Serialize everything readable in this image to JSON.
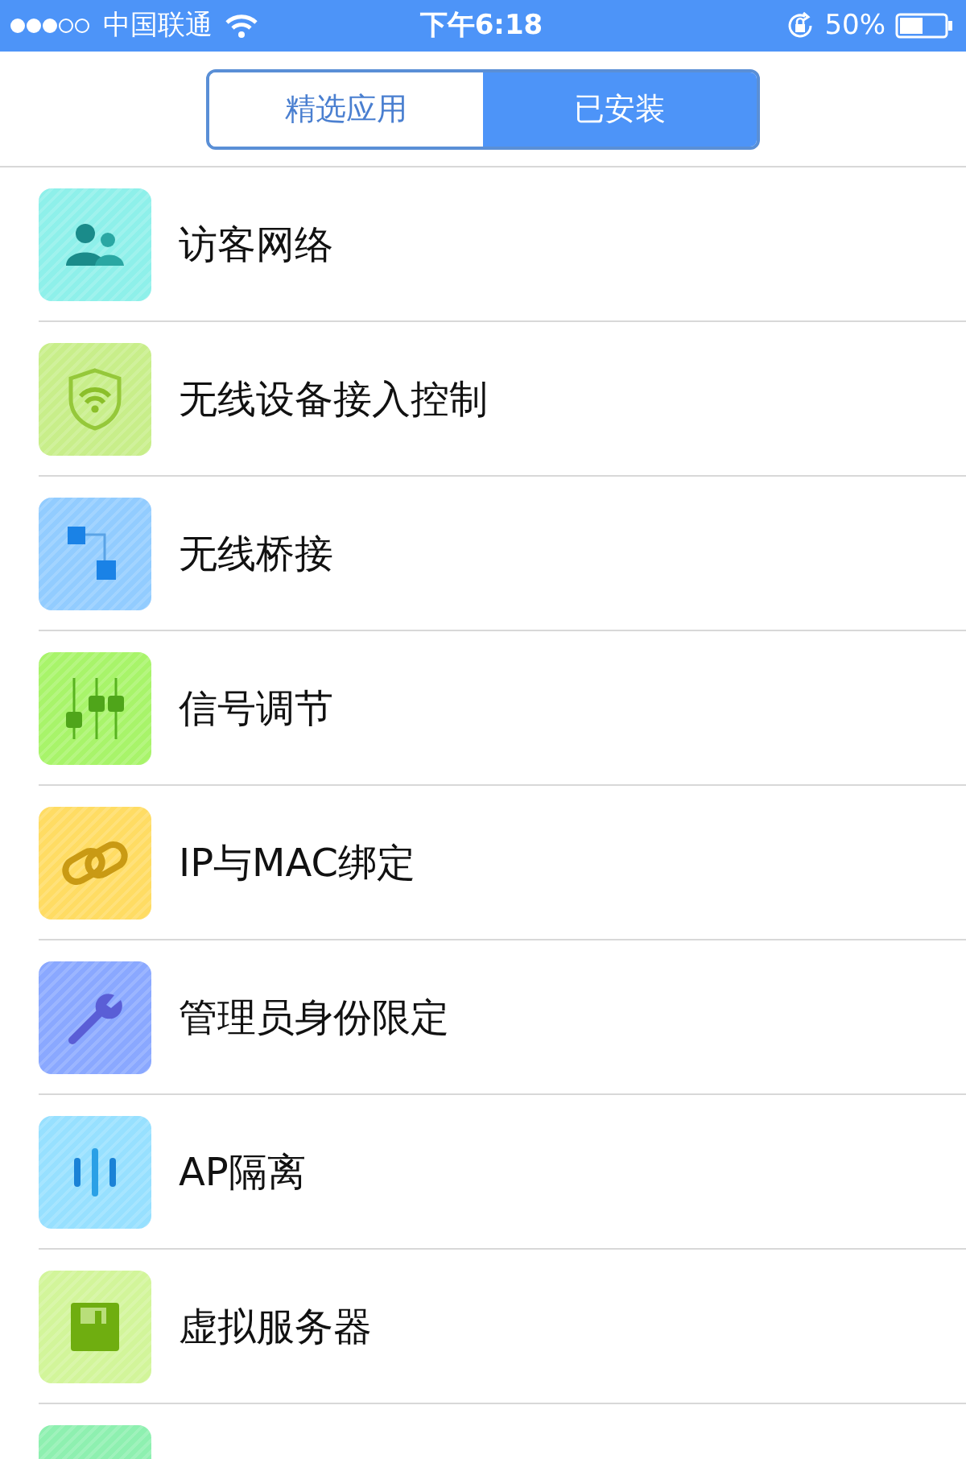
{
  "status_bar": {
    "carrier": "中国联通",
    "time": "下午6:18",
    "battery": "50%"
  },
  "tabs": [
    {
      "label": "精选应用",
      "selected": false
    },
    {
      "label": "已安装",
      "selected": true
    }
  ],
  "items": [
    {
      "label": "访客网络",
      "kind": "guests"
    },
    {
      "label": "无线设备接入控制",
      "kind": "shield"
    },
    {
      "label": "无线桥接",
      "kind": "bridge"
    },
    {
      "label": "信号调节",
      "kind": "sliders"
    },
    {
      "label": "IP与MAC绑定",
      "kind": "link"
    },
    {
      "label": "管理员身份限定",
      "kind": "wrench"
    },
    {
      "label": "AP隔离",
      "kind": "bars"
    },
    {
      "label": "虚拟服务器",
      "kind": "disk"
    },
    {
      "kind": "partial"
    }
  ]
}
